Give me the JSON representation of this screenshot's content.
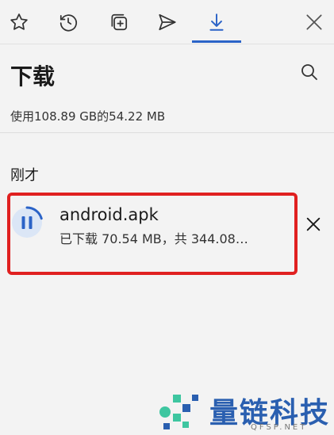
{
  "tabs": [
    {
      "name": "favorites",
      "icon": "star-icon"
    },
    {
      "name": "history",
      "icon": "history-icon"
    },
    {
      "name": "collections",
      "icon": "collections-icon"
    },
    {
      "name": "share",
      "icon": "send-icon"
    },
    {
      "name": "downloads",
      "icon": "download-icon",
      "active": true
    }
  ],
  "close_icon": "close-icon",
  "header": {
    "title": "下载",
    "search_icon": "search-icon"
  },
  "storage": {
    "text": "使用108.89 GB的54.22 MB"
  },
  "section": {
    "label": "刚才"
  },
  "downloads": [
    {
      "file_name": "android.apk",
      "progress_text": "已下载 70.54 MB，共 344.08…",
      "state": "paused-icon",
      "progress_fraction": 0.205
    }
  ],
  "colors": {
    "accent": "#2b63c7",
    "highlight": "#e02020",
    "watermark": "#2a5fb0"
  },
  "watermark": {
    "text": "量链科技",
    "sub": "QFSP.NET"
  }
}
